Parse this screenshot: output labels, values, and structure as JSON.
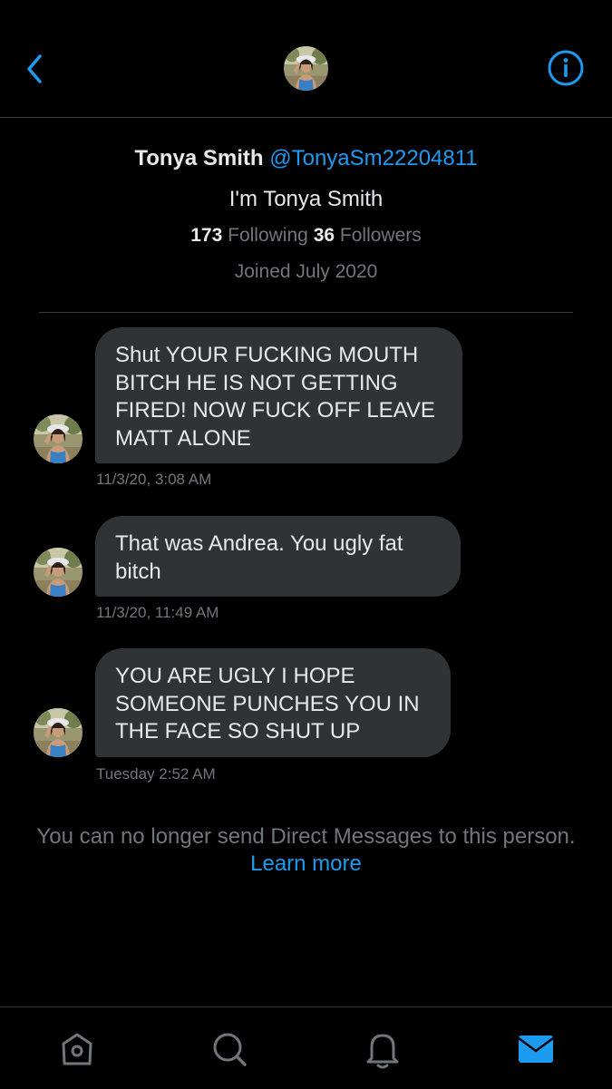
{
  "header": {
    "back_icon": "chevron-left-icon",
    "avatar_alt": "Tonya Smith",
    "info_icon": "info-icon",
    "accent_color": "#1d9bf0"
  },
  "profile": {
    "name": "Tonya Smith",
    "handle": "@TonyaSm22204811",
    "bio": "I'm Tonya Smith",
    "following_count": "173",
    "following_label": "Following",
    "followers_count": "36",
    "followers_label": "Followers",
    "joined": "Joined July 2020"
  },
  "messages": [
    {
      "text": "Shut YOUR FUCKING MOUTH BITCH HE IS NOT GETTING FIRED! NOW FUCK OFF LEAVE MATT ALONE",
      "timestamp": "11/3/20, 3:08 AM"
    },
    {
      "text": "That was Andrea.  You ugly fat bitch",
      "timestamp": "11/3/20, 11:49 AM"
    },
    {
      "text": "YOU ARE UGLY I HOPE SOMEONE PUNCHES YOU IN THE FACE SO SHUT UP",
      "timestamp": "Tuesday 2:52 AM"
    }
  ],
  "notice": {
    "text": "You can no longer send Direct Messages to this person.",
    "link": "Learn more"
  },
  "tabbar": {
    "items": [
      {
        "icon": "home-icon"
      },
      {
        "icon": "search-icon"
      },
      {
        "icon": "bell-icon"
      },
      {
        "icon": "mail-icon",
        "active": true
      }
    ]
  }
}
